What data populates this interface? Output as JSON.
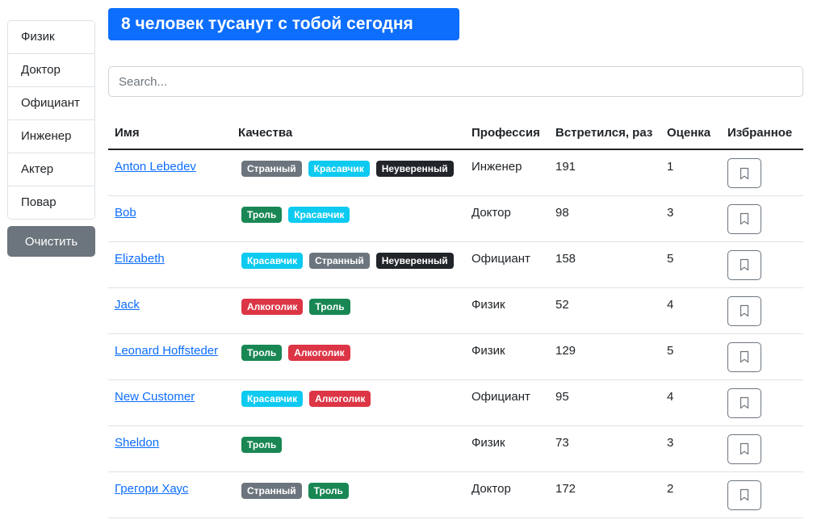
{
  "header": {
    "title": "8 человек тусанут с тобой сегодня"
  },
  "sidebar": {
    "professions": [
      "Физик",
      "Доктор",
      "Официант",
      "Инженер",
      "Актер",
      "Повар"
    ],
    "clear_label": "Очистить"
  },
  "search": {
    "placeholder": "Search...",
    "value": ""
  },
  "table": {
    "columns": [
      "Имя",
      "Качества",
      "Профессия",
      "Встретился, раз",
      "Оценка",
      "Избранное"
    ],
    "rows": [
      {
        "name": "Anton Lebedev",
        "qualities": [
          {
            "label": "Странный",
            "color": "#6c757d"
          },
          {
            "label": "Красавчик",
            "color": "#0dcaf0"
          },
          {
            "label": "Неуверенный",
            "color": "#212529"
          }
        ],
        "profession": "Инженер",
        "met": "191",
        "rate": "1",
        "favorite_icon": "bookmark-outline-icon"
      },
      {
        "name": "Bob",
        "qualities": [
          {
            "label": "Троль",
            "color": "#198754"
          },
          {
            "label": "Красавчик",
            "color": "#0dcaf0"
          }
        ],
        "profession": "Доктор",
        "met": "98",
        "rate": "3",
        "favorite_icon": "bookmark-outline-icon"
      },
      {
        "name": "Elizabeth",
        "qualities": [
          {
            "label": "Красавчик",
            "color": "#0dcaf0"
          },
          {
            "label": "Странный",
            "color": "#6c757d"
          },
          {
            "label": "Неуверенный",
            "color": "#212529"
          }
        ],
        "profession": "Официант",
        "met": "158",
        "rate": "5",
        "favorite_icon": "bookmark-outline-icon"
      },
      {
        "name": "Jack",
        "qualities": [
          {
            "label": "Алкоголик",
            "color": "#dc3545"
          },
          {
            "label": "Троль",
            "color": "#198754"
          }
        ],
        "profession": "Физик",
        "met": "52",
        "rate": "4",
        "favorite_icon": "bookmark-outline-icon"
      },
      {
        "name": "Leonard Hoffsteder",
        "qualities": [
          {
            "label": "Троль",
            "color": "#198754"
          },
          {
            "label": "Алкоголик",
            "color": "#dc3545"
          }
        ],
        "profession": "Физик",
        "met": "129",
        "rate": "5",
        "favorite_icon": "bookmark-outline-icon"
      },
      {
        "name": "New Customer",
        "qualities": [
          {
            "label": "Красавчик",
            "color": "#0dcaf0"
          },
          {
            "label": "Алкоголик",
            "color": "#dc3545"
          }
        ],
        "profession": "Официант",
        "met": "95",
        "rate": "4",
        "favorite_icon": "bookmark-outline-icon"
      },
      {
        "name": "Sheldon",
        "qualities": [
          {
            "label": "Троль",
            "color": "#198754"
          }
        ],
        "profession": "Физик",
        "met": "73",
        "rate": "3",
        "favorite_icon": "bookmark-outline-icon"
      },
      {
        "name": "Грегори Хаус",
        "qualities": [
          {
            "label": "Странный",
            "color": "#6c757d"
          },
          {
            "label": "Троль",
            "color": "#198754"
          }
        ],
        "profession": "Доктор",
        "met": "172",
        "rate": "2",
        "favorite_icon": "bookmark-outline-icon"
      }
    ]
  },
  "colors": {
    "primary": "#0d6efd",
    "secondary": "#6c757d"
  }
}
